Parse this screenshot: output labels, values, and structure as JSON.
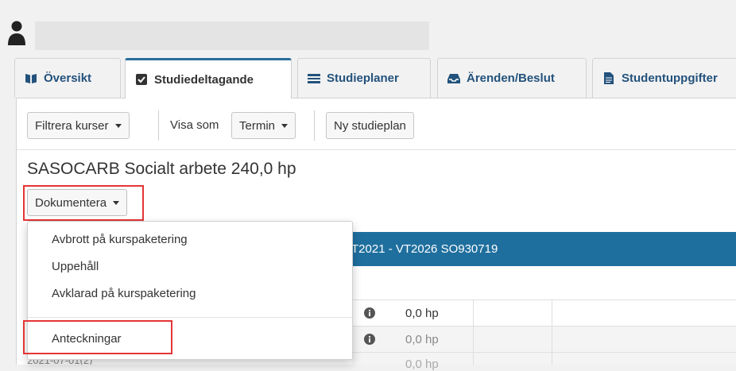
{
  "tabs": [
    {
      "label": "Översikt",
      "icon": "book-icon"
    },
    {
      "label": "Studiedeltagande",
      "icon": "checkbox-icon"
    },
    {
      "label": "Studieplaner",
      "icon": "list-icon"
    },
    {
      "label": "Ärenden/Beslut",
      "icon": "inbox-icon"
    },
    {
      "label": "Studentuppgifter",
      "icon": "document-icon"
    }
  ],
  "toolbar": {
    "filter_label": "Filtrera kurser",
    "view_label": "Visa som",
    "view_value": "Termin",
    "new_plan_label": "Ny studieplan"
  },
  "program": {
    "title": "SASOCARB Socialt arbete 240,0 hp",
    "document_button": "Dokumentera",
    "bar_text": "T2021 - VT2026 SO930719"
  },
  "menu": {
    "items": [
      "Avbrott på kurspaketering",
      "Uppehåll",
      "Avklarad på kurspaketering"
    ],
    "notes": "Anteckningar"
  },
  "table": {
    "rows": [
      {
        "hp": "0,0 hp"
      },
      {
        "hp": "0,0 hp"
      },
      {
        "hp": "0,0 hp"
      }
    ],
    "ghost_text": "2021-07-01(2)"
  },
  "colors": {
    "accent": "#1f6f9e",
    "highlight": "#e53535",
    "link": "#23527c"
  }
}
